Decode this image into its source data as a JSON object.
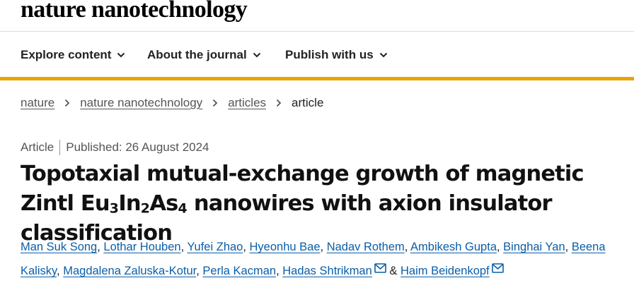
{
  "header": {
    "brand": "nature nanotechnology"
  },
  "nav": {
    "items": [
      {
        "label": "Explore content"
      },
      {
        "label": "About the journal"
      },
      {
        "label": "Publish with us"
      }
    ]
  },
  "breadcrumb": {
    "items": [
      "nature",
      "nature nanotechnology",
      "articles"
    ],
    "current": "article"
  },
  "article": {
    "type": "Article",
    "published": "Published: 26 August 2024",
    "title": {
      "part1": "Topotaxial mutual-exchange growth of magnetic Zintl ",
      "eu": "Eu",
      "sub1": "3",
      "in": "In",
      "sub2": "2",
      "as": "As",
      "sub3": "4",
      "part2": " nanowires with axion insulator classification"
    },
    "authors": [
      "Man Suk Song",
      "Lothar Houben",
      "Yufei Zhao",
      "Hyeonhu Bae",
      "Nadav Rothem",
      "Ambikesh Gupta",
      "Binghai Yan",
      "Beena Kalisky",
      "Magdalena Zaluska-Kotur",
      "Perla Kacman",
      "Hadas Shtrikman",
      "Haim Beidenkopf"
    ],
    "separator": ", ",
    "conjunction": " & "
  },
  "colors": {
    "accent": "#e9a400",
    "author_link": "#0a5ea8",
    "mail_icon": "#0a5ea8"
  },
  "icons": {
    "chevron": "chevron-down-icon",
    "breadcrumb_sep": "chevron-right-icon",
    "mail": "mail-icon"
  }
}
